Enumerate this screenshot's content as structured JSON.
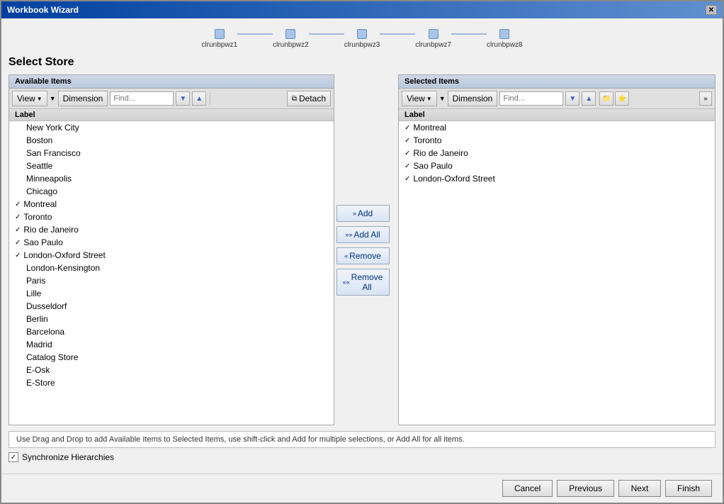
{
  "window": {
    "title": "Workbook Wizard",
    "close_label": "✕"
  },
  "wizard": {
    "steps": [
      {
        "id": "clrunbpwz1",
        "label": "clrunbpwz1"
      },
      {
        "id": "clrunbpwz2",
        "label": "clrunbpwz2"
      },
      {
        "id": "clrunbpwz3",
        "label": "clrunbpwz3"
      },
      {
        "id": "clrunbpwz7",
        "label": "clrunbpwz7"
      },
      {
        "id": "clrunbpwz8",
        "label": "clrunbpwz8"
      }
    ]
  },
  "page_title": "Select Store",
  "available_panel": {
    "title": "Available Items",
    "toolbar": {
      "view_label": "View",
      "dimension_label": "Dimension",
      "find_placeholder": "Find...",
      "detach_label": "Detach"
    },
    "header": "Label",
    "items": [
      {
        "label": "New York City",
        "checked": false
      },
      {
        "label": "Boston",
        "checked": false
      },
      {
        "label": "San Francisco",
        "checked": false
      },
      {
        "label": "Seattle",
        "checked": false
      },
      {
        "label": "Minneapolis",
        "checked": false
      },
      {
        "label": "Chicago",
        "checked": false
      },
      {
        "label": "Montreal",
        "checked": true
      },
      {
        "label": "Toronto",
        "checked": true
      },
      {
        "label": "Rio de Janeiro",
        "checked": true
      },
      {
        "label": "Sao Paulo",
        "checked": true
      },
      {
        "label": "London-Oxford Street",
        "checked": true
      },
      {
        "label": "London-Kensington",
        "checked": false
      },
      {
        "label": "Paris",
        "checked": false
      },
      {
        "label": "Lille",
        "checked": false
      },
      {
        "label": "Dusseldorf",
        "checked": false
      },
      {
        "label": "Berlin",
        "checked": false
      },
      {
        "label": "Barcelona",
        "checked": false
      },
      {
        "label": "Madrid",
        "checked": false
      },
      {
        "label": "Catalog Store",
        "checked": false
      },
      {
        "label": "E-Osk",
        "checked": false
      },
      {
        "label": "E-Store",
        "checked": false
      }
    ]
  },
  "buttons": {
    "add_label": "Add",
    "add_all_label": "Add All",
    "remove_label": "Remove",
    "remove_all_label": "Remove All"
  },
  "selected_panel": {
    "title": "Selected Items",
    "toolbar": {
      "view_label": "View",
      "dimension_label": "Dimension",
      "find_placeholder": "Find..."
    },
    "header": "Label",
    "items": [
      {
        "label": "Montreal",
        "checked": true
      },
      {
        "label": "Toronto",
        "checked": true
      },
      {
        "label": "Rio de Janeiro",
        "checked": true
      },
      {
        "label": "Sao Paulo",
        "checked": true
      },
      {
        "label": "London-Oxford Street",
        "checked": true
      }
    ]
  },
  "info_text": "Use Drag and Drop to add Available Items to Selected Items, use shift-click and Add for multiple selections, or Add All for all items.",
  "sync": {
    "label": "Synchronize Hierarchies",
    "checked": true
  },
  "footer": {
    "cancel_label": "Cancel",
    "previous_label": "Previous",
    "next_label": "Next",
    "finish_label": "Finish"
  }
}
